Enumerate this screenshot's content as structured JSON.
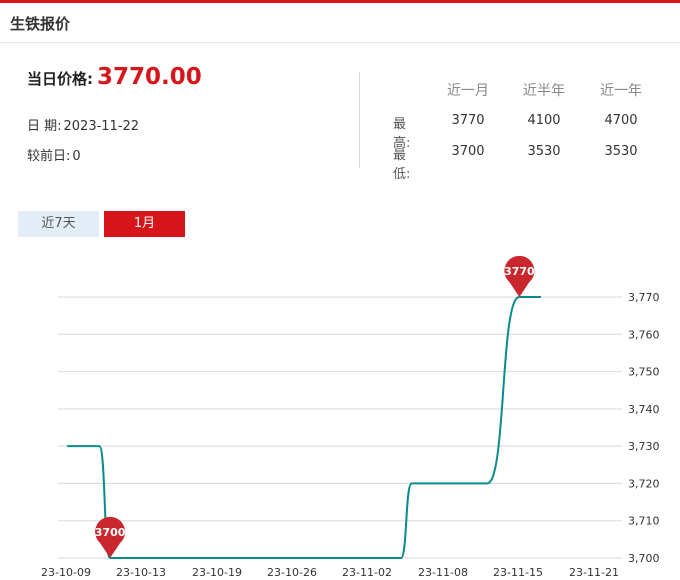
{
  "header": {
    "title": "生铁报价"
  },
  "summary": {
    "price_label": "当日价格:",
    "price_value": "3770.00",
    "date_label": "日 期:",
    "date_value": "2023-11-22",
    "change_label": "较前日:",
    "change_value": "0"
  },
  "stats": {
    "columns": [
      "近一月",
      "近半年",
      "近一年"
    ],
    "rows": [
      {
        "label": "最高:",
        "values": [
          "3770",
          "4100",
          "4700"
        ]
      },
      {
        "label": "最低:",
        "values": [
          "3700",
          "3530",
          "3530"
        ]
      }
    ]
  },
  "tabs": [
    {
      "label": "近7天",
      "active": false
    },
    {
      "label": "1月",
      "active": true
    }
  ],
  "colors": {
    "accent_red": "#d7161b",
    "line": "#0a8c8c",
    "marker": "#c8282d",
    "grid": "#d9d9d9"
  },
  "chart_data": {
    "type": "line",
    "title": "",
    "xlabel": "",
    "ylabel": "",
    "x_ticks": [
      "23-10-09",
      "23-10-13",
      "23-10-19",
      "23-10-26",
      "23-11-02",
      "23-11-08",
      "23-11-15",
      "23-11-21"
    ],
    "y_ticks": [
      3700,
      3710,
      3720,
      3730,
      3740,
      3750,
      3760,
      3770
    ],
    "y_tick_labels": [
      "3,700",
      "3,710",
      "3,720",
      "3,730",
      "3,740",
      "3,750",
      "3,760",
      "3,770"
    ],
    "ylim": [
      3700,
      3770
    ],
    "grid": true,
    "series": [
      {
        "values": [
          [
            "2023-10-09",
            3730
          ],
          [
            "2023-10-10",
            3730
          ],
          [
            "2023-10-11",
            3730
          ],
          [
            "2023-10-12",
            3730
          ],
          [
            "2023-10-13",
            3700
          ],
          [
            "2023-10-16",
            3700
          ],
          [
            "2023-10-17",
            3700
          ],
          [
            "2023-10-18",
            3700
          ],
          [
            "2023-10-19",
            3700
          ],
          [
            "2023-10-20",
            3700
          ],
          [
            "2023-10-23",
            3700
          ],
          [
            "2023-10-24",
            3700
          ],
          [
            "2023-10-25",
            3700
          ],
          [
            "2023-10-26",
            3700
          ],
          [
            "2023-10-27",
            3700
          ],
          [
            "2023-10-30",
            3700
          ],
          [
            "2023-10-31",
            3700
          ],
          [
            "2023-11-01",
            3700
          ],
          [
            "2023-11-02",
            3700
          ],
          [
            "2023-11-03",
            3700
          ],
          [
            "2023-11-06",
            3700
          ],
          [
            "2023-11-07",
            3700
          ],
          [
            "2023-11-08",
            3700
          ],
          [
            "2023-11-09",
            3700
          ],
          [
            "2023-11-10",
            3720
          ],
          [
            "2023-11-13",
            3720
          ],
          [
            "2023-11-14",
            3720
          ],
          [
            "2023-11-15",
            3720
          ],
          [
            "2023-11-16",
            3720
          ],
          [
            "2023-11-17",
            3720
          ],
          [
            "2023-11-20",
            3770
          ],
          [
            "2023-11-21",
            3770
          ],
          [
            "2023-11-22",
            3770
          ]
        ]
      }
    ],
    "markers": [
      {
        "label": "3770",
        "date": "2023-11-20",
        "value": 3770,
        "kind": "max"
      },
      {
        "label": "3700",
        "date": "2023-10-13",
        "value": 3700,
        "kind": "min"
      }
    ]
  }
}
